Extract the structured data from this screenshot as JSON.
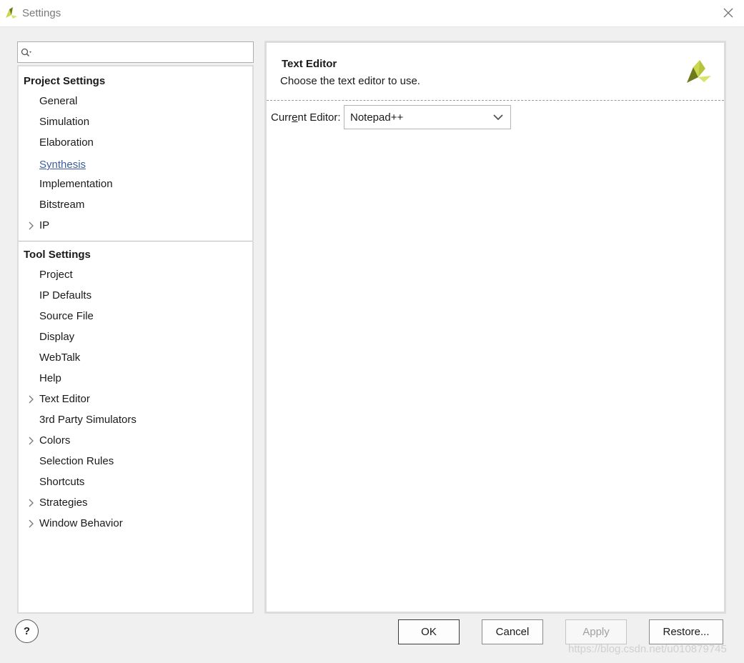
{
  "window": {
    "title": "Settings",
    "logo_icon": "vivado-logo-icon",
    "close_icon": "close-icon"
  },
  "search": {
    "placeholder": "",
    "value": "",
    "icon": "search-icon"
  },
  "tree": {
    "project_settings": {
      "title": "Project Settings",
      "items": [
        {
          "label": "General",
          "expandable": false,
          "active": false
        },
        {
          "label": "Simulation",
          "expandable": false,
          "active": false
        },
        {
          "label": "Elaboration",
          "expandable": false,
          "active": false
        },
        {
          "label": "Synthesis",
          "expandable": false,
          "active": true
        },
        {
          "label": "Implementation",
          "expandable": false,
          "active": false
        },
        {
          "label": "Bitstream",
          "expandable": false,
          "active": false
        },
        {
          "label": "IP",
          "expandable": true,
          "active": false
        }
      ]
    },
    "tool_settings": {
      "title": "Tool Settings",
      "items": [
        {
          "label": "Project",
          "expandable": false
        },
        {
          "label": "IP Defaults",
          "expandable": false
        },
        {
          "label": "Source File",
          "expandable": false
        },
        {
          "label": "Display",
          "expandable": false
        },
        {
          "label": "WebTalk",
          "expandable": false
        },
        {
          "label": "Help",
          "expandable": false
        },
        {
          "label": "Text Editor",
          "expandable": true
        },
        {
          "label": "3rd Party Simulators",
          "expandable": false
        },
        {
          "label": "Colors",
          "expandable": true
        },
        {
          "label": "Selection Rules",
          "expandable": false
        },
        {
          "label": "Shortcuts",
          "expandable": false
        },
        {
          "label": "Strategies",
          "expandable": true
        },
        {
          "label": "Window Behavior",
          "expandable": true
        }
      ]
    }
  },
  "content": {
    "title": "Text Editor",
    "subtitle": "Choose the text editor to use.",
    "field_label_pre": "Curr",
    "field_label_underlined": "e",
    "field_label_post": "nt Editor:",
    "editor_value": "Notepad++"
  },
  "buttons": {
    "help": "?",
    "ok": "OK",
    "cancel": "Cancel",
    "apply": "Apply",
    "restore": "Restore..."
  },
  "watermark": "https://blog.csdn.net/u010879745",
  "colors": {
    "link": "#3b5f9e",
    "logo_light": "#c9d84c",
    "logo_dark": "#6e7a1c"
  }
}
